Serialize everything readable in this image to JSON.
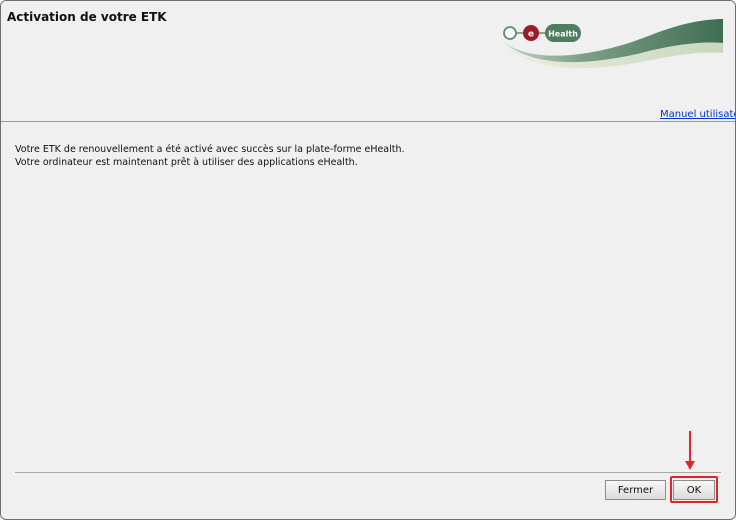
{
  "dialog": {
    "title": "Activation de votre ETK"
  },
  "logo": {
    "text": "Health",
    "letter": "e"
  },
  "header": {
    "manual_link": "Manuel utilisateur"
  },
  "message": {
    "line1": "Votre ETK de renouvellement a été activé avec succès sur la plate-forme eHealth.",
    "line2": "Votre ordinateur est maintenant prêt à utiliser des applications eHealth."
  },
  "buttons": {
    "close_label": "Fermer",
    "ok_label": "OK"
  },
  "colors": {
    "logo_green": "#4f7d5f",
    "logo_red": "#9b1b2a",
    "link": "#0033cc",
    "highlight": "#e0262b"
  }
}
